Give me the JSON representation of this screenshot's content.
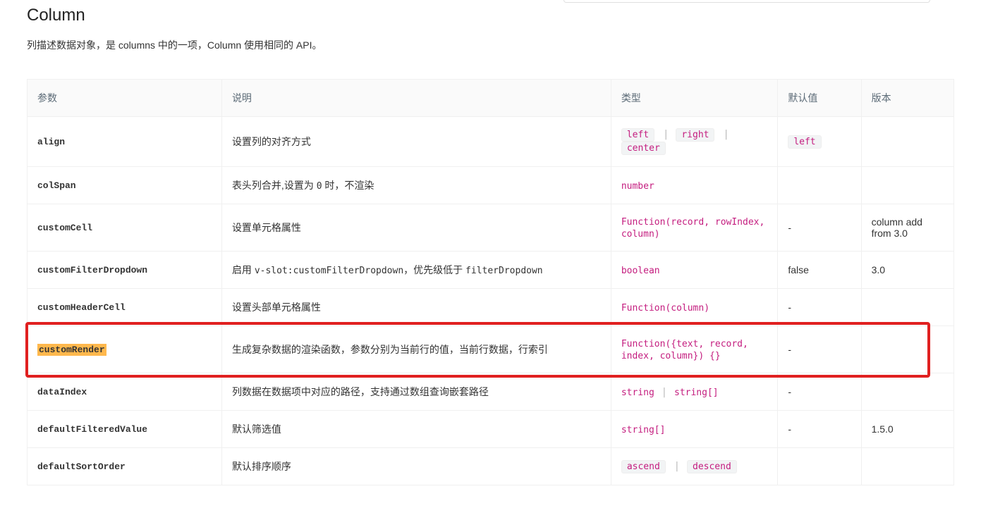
{
  "heading": "Column",
  "intro": "列描述数据对象，是 columns 中的一项，Column 使用相同的 API。",
  "headers": {
    "param": "参数",
    "desc": "说明",
    "type": "类型",
    "default": "默认值",
    "version": "版本"
  },
  "rows": {
    "align": {
      "param": "align",
      "desc": "设置列的对齐方式",
      "type_parts": [
        "left",
        "right",
        "center"
      ],
      "default_tag": "left",
      "version": ""
    },
    "colSpan": {
      "param": "colSpan",
      "desc_prefix": "表头列合并,设置为 ",
      "desc_code": "0",
      "desc_suffix": " 时，不渲染",
      "type_plain": "number",
      "default": "",
      "version": ""
    },
    "customCell": {
      "param": "customCell",
      "desc": "设置单元格属性",
      "type_plain": "Function(record, rowIndex, column)",
      "default": "-",
      "version": "column add from 3.0"
    },
    "customFilterDropdown": {
      "param": "customFilterDropdown",
      "desc_prefix": "启用 ",
      "desc_code1": "v-slot:customFilterDropdown",
      "desc_mid": "，优先级低于 ",
      "desc_code2": "filterDropdown",
      "type_plain": "boolean",
      "default": "false",
      "version": "3.0"
    },
    "customHeaderCell": {
      "param": "customHeaderCell",
      "desc": "设置头部单元格属性",
      "type_plain": "Function(column)",
      "default": "-",
      "version": ""
    },
    "customRender": {
      "param": "customRender",
      "desc": "生成复杂数据的渲染函数，参数分别为当前行的值，当前行数据，行索引",
      "type_plain": "Function({text, record, index, column}) {}",
      "default": "-",
      "version": ""
    },
    "dataIndex": {
      "param": "dataIndex",
      "desc": "列数据在数据项中对应的路径，支持通过数组查询嵌套路径",
      "type_parts": [
        "string",
        "string[]"
      ],
      "default": "-",
      "version": ""
    },
    "defaultFilteredValue": {
      "param": "defaultFilteredValue",
      "desc": "默认筛选值",
      "type_plain": "string[]",
      "default": "-",
      "version": "1.5.0"
    },
    "defaultSortOrder": {
      "param": "defaultSortOrder",
      "desc": "默认排序顺序",
      "type_parts": [
        "ascend",
        "descend"
      ],
      "default": "",
      "version": ""
    }
  }
}
